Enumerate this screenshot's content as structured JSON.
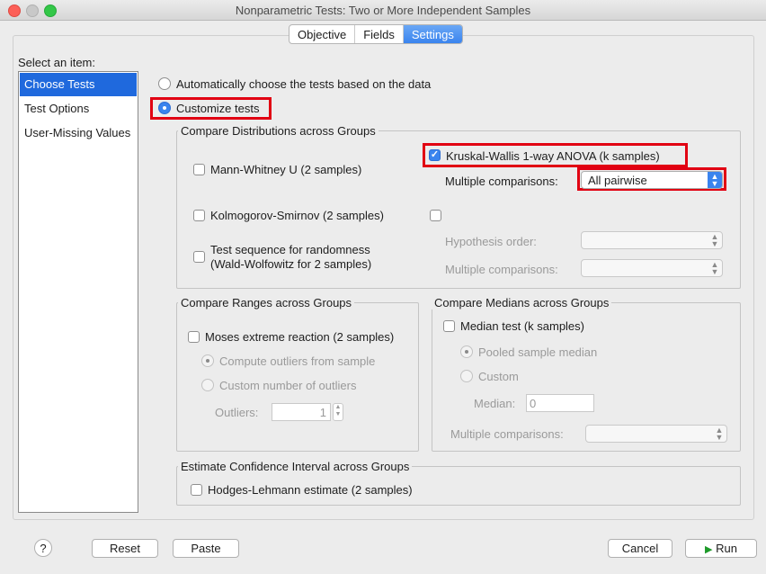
{
  "window": {
    "title": "Nonparametric Tests: Two or More Independent Samples",
    "colors": {
      "close": "#fc5f57",
      "minimize": "#c8c8c8",
      "zoom": "#33c748",
      "accent": "#3a84ee",
      "highlight": "#e10012"
    }
  },
  "tabs": [
    {
      "label": "Objective",
      "active": false
    },
    {
      "label": "Fields",
      "active": false
    },
    {
      "label": "Settings",
      "active": true
    }
  ],
  "sidebar": {
    "heading": "Select an item:",
    "items": [
      {
        "label": "Choose Tests",
        "selected": true
      },
      {
        "label": "Test Options",
        "selected": false
      },
      {
        "label": "User-Missing Values",
        "selected": false
      }
    ]
  },
  "mode": {
    "auto_label": "Automatically choose the tests based on the data",
    "custom_label": "Customize tests",
    "selected": "custom"
  },
  "distributions": {
    "title": "Compare Distributions across Groups",
    "mann_whitney": "Mann-Whitney U (2 samples)",
    "kolmogorov": "Kolmogorov-Smirnov (2 samples)",
    "randomness_line1": "Test sequence for randomness",
    "randomness_line2": "(Wald-Wolfowitz for 2 samples)",
    "kruskal": "Kruskal-Wallis 1-way ANOVA (k samples)",
    "kruskal_checked": true,
    "multiple_comparisons_label": "Multiple comparisons:",
    "multiple_comparisons_value": "All pairwise",
    "hypothesis_order_label": "Hypothesis order:",
    "multiple_comparisons2_label": "Multiple comparisons:"
  },
  "ranges": {
    "title": "Compare Ranges across Groups",
    "moses": "Moses extreme reaction (2 samples)",
    "compute_outliers": "Compute outliers from sample",
    "custom_outliers": "Custom number of outliers",
    "outliers_label": "Outliers:",
    "outliers_value": "1"
  },
  "medians": {
    "title": "Compare Medians across Groups",
    "median_test": "Median test (k samples)",
    "pooled": "Pooled sample median",
    "custom": "Custom",
    "median_label": "Median:",
    "median_value": "0",
    "multiple_comparisons_label": "Multiple comparisons:"
  },
  "confidence": {
    "title": "Estimate Confidence Interval across Groups",
    "hodges": "Hodges-Lehmann estimate (2 samples)"
  },
  "footer": {
    "help": "?",
    "reset": "Reset",
    "paste": "Paste",
    "cancel": "Cancel",
    "run": "Run"
  }
}
